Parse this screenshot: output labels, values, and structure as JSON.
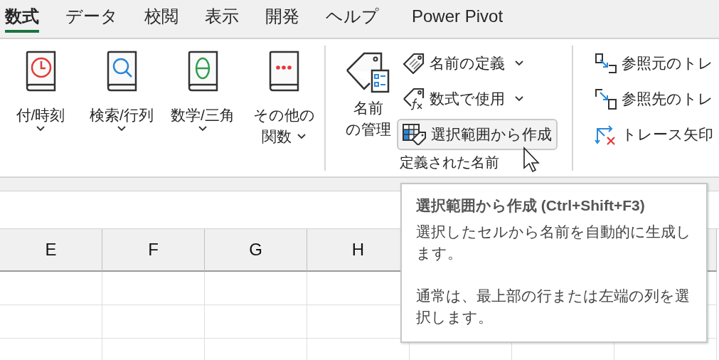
{
  "tabs": [
    {
      "label": "数式",
      "selected": true
    },
    {
      "label": "データ",
      "selected": false
    },
    {
      "label": "校閲",
      "selected": false
    },
    {
      "label": "表示",
      "selected": false
    },
    {
      "label": "開発",
      "selected": false
    },
    {
      "label": "ヘルプ",
      "selected": false
    },
    {
      "label": "Power Pivot",
      "selected": false
    }
  ],
  "ribbon": {
    "groups": [
      {
        "large_buttons": [
          {
            "kind": "clock",
            "lines": [
              "付/時刻"
            ],
            "dropdown": true
          },
          {
            "kind": "search",
            "lines": [
              "検索/行列"
            ],
            "dropdown": true
          },
          {
            "kind": "theta",
            "lines": [
              "数学/三角"
            ],
            "dropdown": true
          },
          {
            "kind": "dots",
            "lines": [
              "その他の",
              "関数"
            ],
            "dropdown": true
          }
        ]
      },
      {
        "large_buttons": [
          {
            "kind": "name-manager",
            "lines": [
              "名前",
              "の管理"
            ],
            "dropdown": false
          }
        ],
        "small_buttons": [
          {
            "kind": "tag",
            "label": "名前の定義",
            "dropdown": true,
            "hovered": false
          },
          {
            "kind": "tag-fx",
            "label": "数式で使用",
            "dropdown": true,
            "hovered": false
          },
          {
            "kind": "table-tag",
            "label": "選択範囲から作成",
            "dropdown": false,
            "hovered": true
          }
        ],
        "label": "定義された名前"
      },
      {
        "small_buttons": [
          {
            "kind": "precedents",
            "label": "参照元のトレ",
            "dropdown": false,
            "hovered": false
          },
          {
            "kind": "dependents",
            "label": "参照先のトレ",
            "dropdown": false,
            "hovered": false
          },
          {
            "kind": "remove-arrows",
            "label": "トレース矢印",
            "dropdown": false,
            "hovered": false
          }
        ]
      }
    ]
  },
  "sheet": {
    "columns": [
      "E",
      "F",
      "G",
      "H"
    ]
  },
  "tooltip": {
    "title": "選択範囲から作成 (Ctrl+Shift+F3)",
    "paragraphs": [
      "選択したセルから名前を自動的に生成します。",
      "通常は、最上部の行または左端の列を選択します。"
    ]
  }
}
